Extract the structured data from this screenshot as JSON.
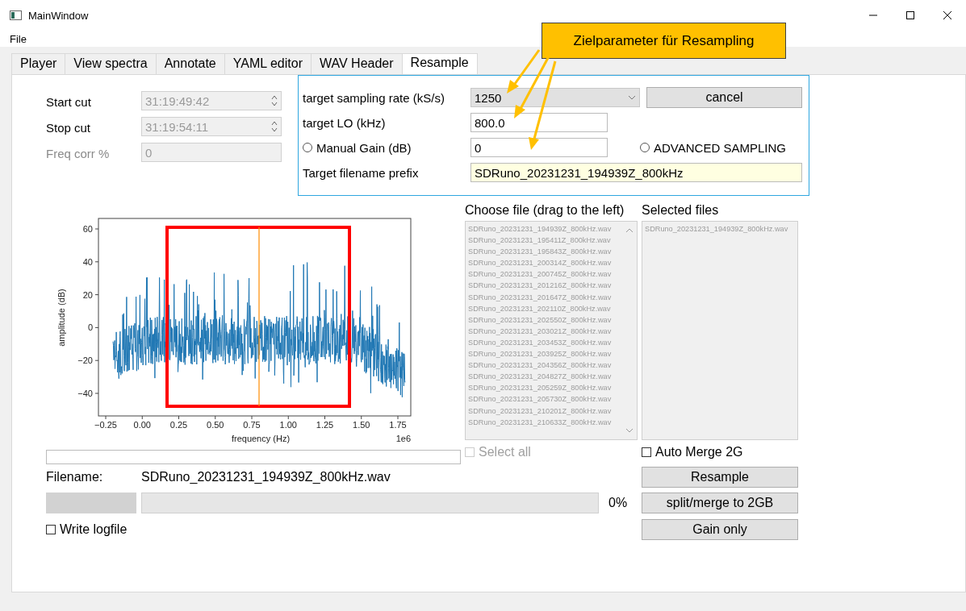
{
  "window": {
    "title": "MainWindow"
  },
  "menu": [
    "File"
  ],
  "tabs": [
    {
      "label": "Player",
      "selected": false
    },
    {
      "label": "View spectra",
      "selected": false
    },
    {
      "label": "Annotate",
      "selected": false
    },
    {
      "label": "YAML editor",
      "selected": false
    },
    {
      "label": "WAV Header",
      "selected": false
    },
    {
      "label": "Resample",
      "selected": true
    }
  ],
  "cut_fields": [
    {
      "kind": "spin",
      "label": "Start cut",
      "label_disabled": false,
      "value": "31:19:49:42",
      "disabled": true
    },
    {
      "kind": "spin",
      "label": "Stop cut",
      "label_disabled": false,
      "value": "31:19:54:11",
      "disabled": true
    },
    {
      "kind": "plain",
      "label": "Freq corr %",
      "label_disabled": true,
      "value": "0",
      "disabled": true
    }
  ],
  "target": {
    "rows": [
      {
        "kind": "combo",
        "label": "target sampling rate (kS/s)",
        "value": "1250"
      },
      {
        "kind": "text",
        "label": "target LO (kHz)",
        "value": "800.0"
      },
      {
        "kind": "radio",
        "label": "Manual Gain (dB)",
        "selected": false,
        "value": "0"
      },
      {
        "kind": "prefix",
        "label": "Target filename prefix",
        "value": "SDRuno_20231231_194939Z_800kHz"
      }
    ],
    "cancel_button": "cancel",
    "advanced": {
      "label": "ADVANCED SAMPLING",
      "selected": false
    }
  },
  "plot": {
    "ylabel": "amplitude (dB)",
    "xlabel": "frequency (Hz)",
    "offset": "1e6",
    "yticks": [
      "60",
      "40",
      "20",
      "0",
      "−20",
      "−40"
    ],
    "xticks": [
      "−0.25",
      "0.00",
      "0.25",
      "0.50",
      "0.75",
      "1.00",
      "1.25",
      "1.50",
      "1.75"
    ]
  },
  "file_list": {
    "label": "Choose file (drag to the left)",
    "files": [
      "SDRuno_20231231_194939Z_800kHz.wav",
      "SDRuno_20231231_195411Z_800kHz.wav",
      "SDRuno_20231231_195843Z_800kHz.wav",
      "SDRuno_20231231_200314Z_800kHz.wav",
      "SDRuno_20231231_200745Z_800kHz.wav",
      "SDRuno_20231231_201216Z_800kHz.wav",
      "SDRuno_20231231_201647Z_800kHz.wav",
      "SDRuno_20231231_202110Z_800kHz.wav",
      "SDRuno_20231231_202550Z_800kHz.wav",
      "SDRuno_20231231_203021Z_800kHz.wav",
      "SDRuno_20231231_203453Z_800kHz.wav",
      "SDRuno_20231231_203925Z_800kHz.wav",
      "SDRuno_20231231_204356Z_800kHz.wav",
      "SDRuno_20231231_204827Z_800kHz.wav",
      "SDRuno_20231231_205259Z_800kHz.wav",
      "SDRuno_20231231_205730Z_800kHz.wav",
      "SDRuno_20231231_210201Z_800kHz.wav",
      "SDRuno_20231231_210633Z_800kHz.wav"
    ]
  },
  "selected_list": {
    "label": "Selected files",
    "files": [
      "SDRuno_20231231_194939Z_800kHz.wav"
    ]
  },
  "select_all": {
    "label": "Select all",
    "checked": false,
    "disabled": true
  },
  "auto_merge": {
    "label": "Auto Merge 2G",
    "checked": false
  },
  "filename": {
    "label": "Filename:",
    "value": "SDRuno_20231231_194939Z_800kHz.wav"
  },
  "progress": {
    "level": 0,
    "reading": "0%"
  },
  "write_logfile": {
    "label": "Write logfile",
    "checked": false
  },
  "buttons": [
    "Resample",
    "split/merge to 2GB",
    "Gain only"
  ],
  "callout": {
    "text": "Zielparameter für Resampling"
  }
}
